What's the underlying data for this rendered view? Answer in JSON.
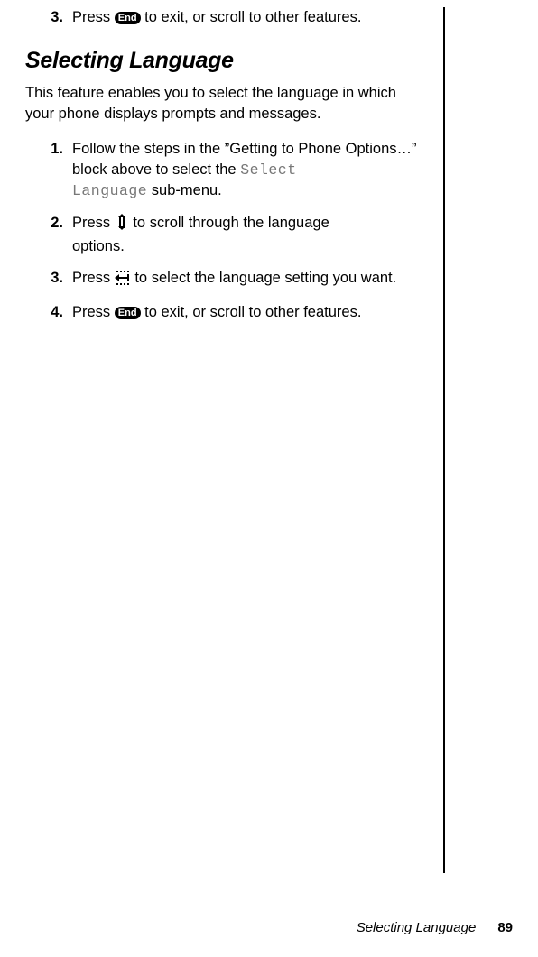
{
  "top_step": {
    "num": "3.",
    "pre": "Press ",
    "key_label": "End",
    "post": " to exit, or scroll to other features."
  },
  "heading": "Selecting Language",
  "intro": "This feature enables you to select the language in which your phone displays prompts and messages.",
  "steps": {
    "s1": {
      "num": "1.",
      "pre": "Follow the steps in the ”Getting to Phone Options…” block above to select the ",
      "lcd1": "Select",
      "lcd2": "Language",
      "post": " sub-menu."
    },
    "s2": {
      "num": "2.",
      "pre": "Press ",
      "post1": " to scroll through the language ",
      "post2": "options."
    },
    "s3": {
      "num": "3.",
      "pre": "Press ",
      "post": " to select the language setting you want."
    },
    "s4": {
      "num": "4.",
      "pre": "Press ",
      "key_label": "End",
      "post": " to exit, or scroll to other features."
    }
  },
  "footer": {
    "title": "Selecting Language",
    "page": "89"
  }
}
